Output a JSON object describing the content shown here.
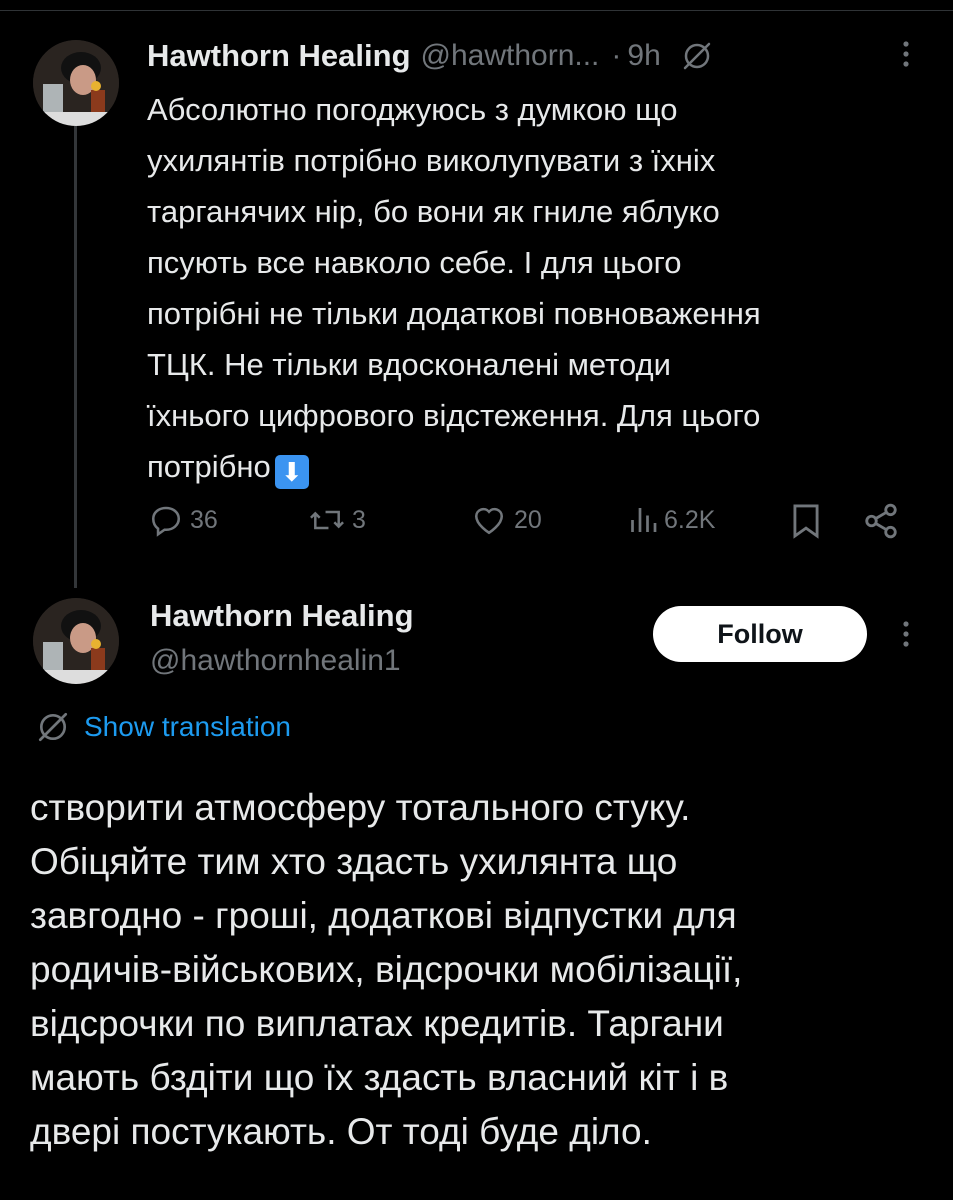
{
  "tweet1": {
    "display_name": "Hawthorn Healing",
    "handle": "@hawthorn...",
    "separator": "·",
    "time": "9h",
    "text": "Абсолютно погоджуюсь з думкою що\nухилянтів потрібно виколупувати з їхніх\nтарганячих нір, бо вони як гниле яблуко\nпсують все навколо себе. І для цього\nпотрібні не тільки додаткові повноваження\nТЦК. Не тільки вдосконалені методи\nїхнього цифрового відстеження. Для цього\nпотрібно",
    "emoji": "⬇",
    "actions": {
      "replies": "36",
      "reposts": "3",
      "likes": "20",
      "views": "6.2K"
    }
  },
  "tweet2": {
    "display_name": "Hawthorn Healing",
    "handle": "@hawthornhealin1",
    "follow_label": "Follow",
    "translate_label": "Show translation",
    "text": "створити атмосферу тотального стуку.\nОбіцяйте тим хто здасть ухилянта що\nзавгодно - гроші, додаткові відпустки для\nродичів-військових, відсрочки мобілізації,\nвідсрочки по виплатах кредитів. Таргани\nмають бздіти що їх здасть власний кіт і в\nдвері постукають. От тоді буде діло."
  },
  "colors": {
    "background": "#000000",
    "text": "#e7e9ea",
    "secondary": "#71767b",
    "accent": "#1d9bf0",
    "follow_bg": "#ffffff"
  }
}
